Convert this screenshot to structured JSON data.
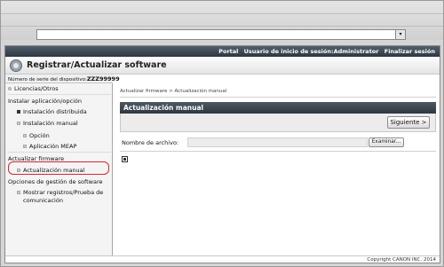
{
  "browser": {
    "dropdown_glyph": "▾"
  },
  "topbar": {
    "portal": "Portal",
    "user_session": "Usuario de inicio de sesión:Administrator",
    "logout": "Finalizar sesión"
  },
  "app": {
    "title": "Registrar/Actualizar software",
    "serial_label": "Número de serie del dispositivo:",
    "serial_value": "ZZZ99999"
  },
  "sidebar": {
    "licenses": "Licencias/Otros",
    "install_section": "Instalar aplicación/opción",
    "distributed_install": "Instalación distribuida",
    "manual_install": "Instalación manual",
    "option": "Opción",
    "meap_app": "Aplicación MEAP",
    "update_firmware_section": "Actualizar firmware",
    "manual_update": "Actualización manual",
    "software_options_section": "Opciones de gestión de software",
    "show_logs_line1": "Mostrar registros/Prueba de",
    "show_logs_line2": "comunicación"
  },
  "main": {
    "breadcrumb": "Actualizar firmware > Actualización manual",
    "panel_title": "Actualización manual",
    "next_button": "Siguiente >",
    "file_label": "Nombre de archivo:",
    "file_value": "",
    "browse_button": "Examinar..."
  },
  "footer": {
    "copyright": "Copyright CANON INC. 2014"
  },
  "colors": {
    "highlight": "#d6262f",
    "header_dark": "#2d3740"
  }
}
